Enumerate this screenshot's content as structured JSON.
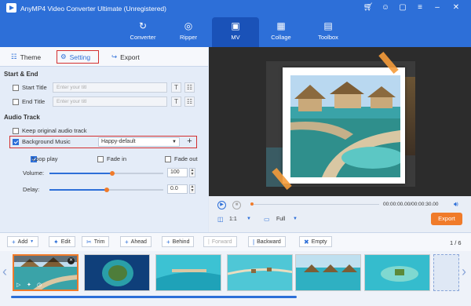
{
  "app": {
    "title": "AnyMP4 Video Converter Ultimate (Unregistered)"
  },
  "window_icons": [
    "cart-icon",
    "user-icon",
    "chat-icon",
    "menu-icon",
    "minimize-icon",
    "close-icon"
  ],
  "nav": [
    {
      "label": "Converter",
      "icon": "converter-icon"
    },
    {
      "label": "Ripper",
      "icon": "ripper-icon"
    },
    {
      "label": "MV",
      "icon": "mv-icon",
      "active": true
    },
    {
      "label": "Collage",
      "icon": "collage-icon"
    },
    {
      "label": "Toolbox",
      "icon": "toolbox-icon"
    }
  ],
  "tabs": {
    "theme": "Theme",
    "setting": "Setting",
    "export": "Export"
  },
  "start_end": {
    "title": "Start & End",
    "start_label": "Start Title",
    "start_placeholder": "Enter your titl",
    "end_label": "End Title",
    "end_placeholder": "Enter your titl"
  },
  "audio": {
    "title": "Audio Track",
    "keep_original": "Keep original audio track",
    "bgm_label": "Background Music",
    "bgm_value": "Happy-default",
    "loop_play": "Loop play",
    "fade_in": "Fade in",
    "fade_out": "Fade out",
    "volume_label": "Volume:",
    "volume_value": "100",
    "volume_level": 0.55,
    "delay_label": "Delay:",
    "delay_value": "0.0",
    "delay_level": 0.5
  },
  "player": {
    "time": "00:00:00.00/00:00:30.00",
    "ratio": "1:1",
    "display_mode": "Full",
    "export_label": "Export"
  },
  "toolbar": {
    "add": "Add",
    "edit": "Edit",
    "trim": "Trim",
    "ahead": "Ahead",
    "behind": "Behind",
    "forward": "Forward",
    "backward": "Backward",
    "empty": "Empty",
    "page": "1 / 6"
  },
  "colors": {
    "accent": "#2d6fd8",
    "orange": "#f07b2a",
    "highlight": "#d32f2f"
  }
}
